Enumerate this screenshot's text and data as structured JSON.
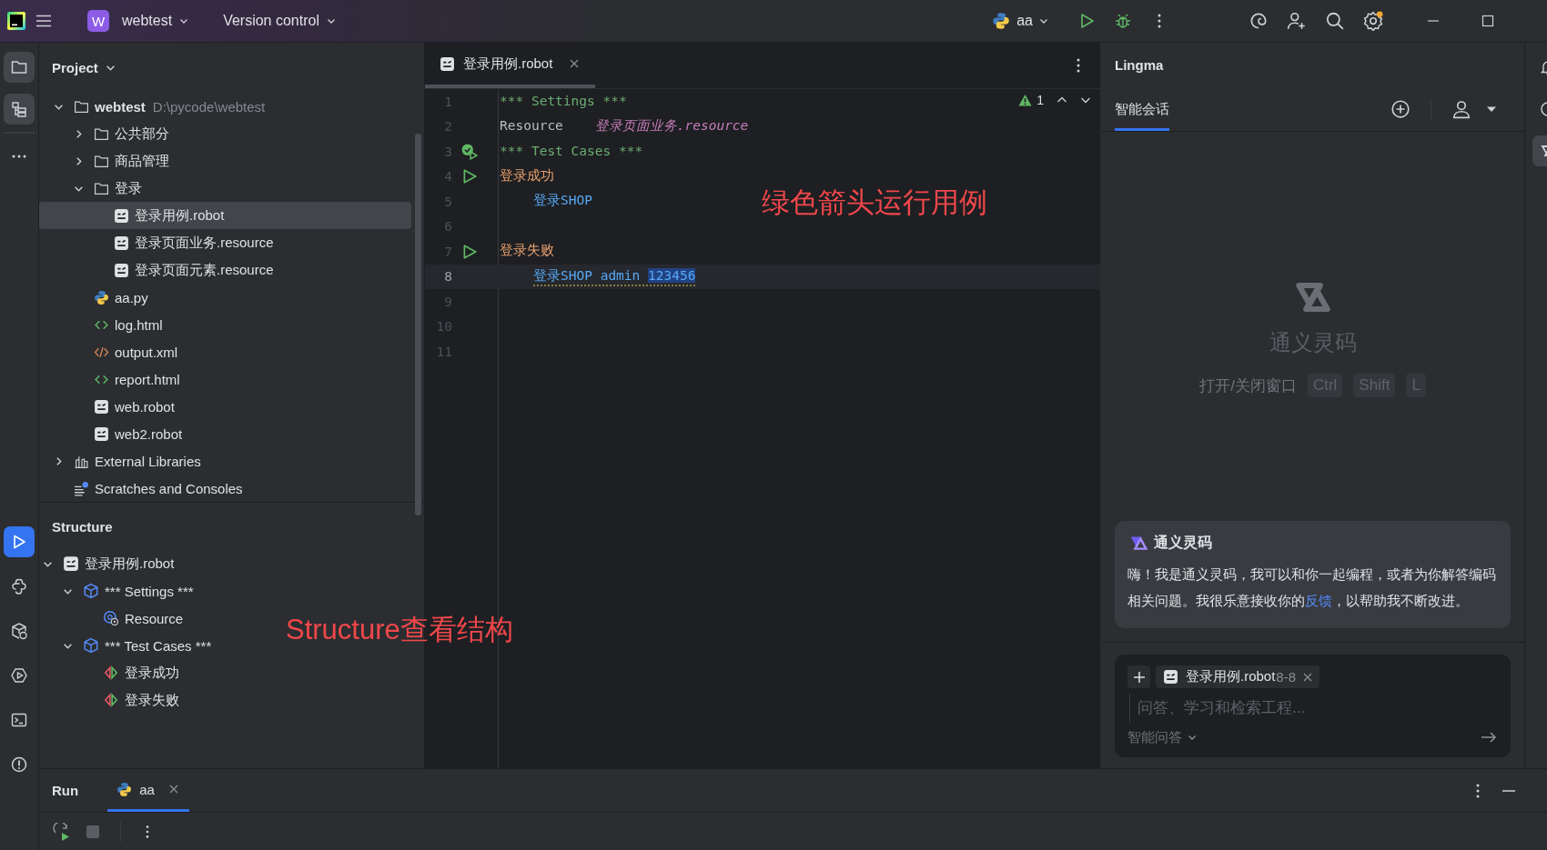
{
  "title_bar": {
    "project_badge": "W",
    "project": "webtest",
    "vcs": "Version control",
    "run_config": "aa"
  },
  "left_toolbar": {
    "top": [
      {
        "kind": "project",
        "selected": true
      },
      {
        "kind": "structure",
        "selected": true
      },
      {
        "kind": "more",
        "selected": false
      }
    ],
    "bottom": [
      {
        "kind": "run",
        "selected": true
      },
      {
        "kind": "python_console",
        "selected": false
      },
      {
        "kind": "packages",
        "selected": false
      },
      {
        "kind": "services",
        "selected": false
      },
      {
        "kind": "terminal",
        "selected": false
      },
      {
        "kind": "problems",
        "selected": false
      }
    ]
  },
  "project_panel": {
    "title": "Project",
    "tree": [
      {
        "label": "webtest",
        "path": "D:\\pycode\\webtest",
        "kind": "folder",
        "expanded": true,
        "selected": false,
        "children": [
          {
            "label": "公共部分",
            "kind": "folder",
            "expanded": false,
            "selected": false
          },
          {
            "label": "商品管理",
            "kind": "folder",
            "expanded": false,
            "selected": false
          },
          {
            "label": "登录",
            "kind": "folder",
            "expanded": true,
            "selected": false,
            "children": [
              {
                "label": "登录用例.robot",
                "kind": "robot",
                "selected": true
              },
              {
                "label": "登录页面业务.resource",
                "kind": "robot",
                "selected": false
              },
              {
                "label": "登录页面元素.resource",
                "kind": "robot",
                "selected": false
              }
            ]
          },
          {
            "label": "aa.py",
            "kind": "python",
            "selected": false
          },
          {
            "label": "log.html",
            "kind": "html",
            "selected": false
          },
          {
            "label": "output.xml",
            "kind": "xml",
            "selected": false
          },
          {
            "label": "report.html",
            "kind": "html",
            "selected": false
          },
          {
            "label": "web.robot",
            "kind": "robot",
            "selected": false
          },
          {
            "label": "web2.robot",
            "kind": "robot",
            "selected": false
          }
        ]
      },
      {
        "label": "External Libraries",
        "kind": "library",
        "expanded": false,
        "selected": false
      },
      {
        "label": "Scratches and Consoles",
        "kind": "scratches",
        "selected": false
      }
    ]
  },
  "structure_panel": {
    "title": "Structure",
    "tree": [
      {
        "label": "登录用例.robot",
        "kind": "robot",
        "expanded": true,
        "selected": false,
        "children": [
          {
            "label": "*** Settings ***",
            "kind": "section",
            "expanded": true,
            "selected": false,
            "children": [
              {
                "label": "Resource",
                "kind": "resource",
                "selected": false
              }
            ]
          },
          {
            "label": "*** Test Cases ***",
            "kind": "section",
            "expanded": true,
            "selected": false,
            "children": [
              {
                "label": "登录成功",
                "kind": "testcase",
                "selected": false
              },
              {
                "label": "登录失败",
                "kind": "testcase",
                "selected": false
              }
            ]
          }
        ]
      }
    ]
  },
  "editor": {
    "tabs": [
      {
        "label": "登录用例.robot",
        "selected": true
      }
    ],
    "warning_count": "1",
    "lines": [
      {
        "number": "1",
        "runnable": false,
        "current": false,
        "indented": false,
        "warning": false,
        "tokens": [
          {
            "text": "*** Settings ***",
            "kind": "header",
            "selected": false
          }
        ]
      },
      {
        "number": "2",
        "runnable": false,
        "current": false,
        "indented": false,
        "warning": false,
        "tokens": [
          {
            "text": "Resource    ",
            "kind": "setting",
            "selected": false
          },
          {
            "text": "登录页面业务.resource",
            "kind": "path",
            "selected": false
          }
        ]
      },
      {
        "number": "3",
        "runnable": true,
        "passed": true,
        "current": false,
        "indented": false,
        "warning": false,
        "tokens": [
          {
            "text": "*** Test Cases ***",
            "kind": "header",
            "selected": false
          }
        ]
      },
      {
        "number": "4",
        "runnable": true,
        "passed": false,
        "current": false,
        "indented": false,
        "warning": false,
        "tokens": [
          {
            "text": "登录成功",
            "kind": "testcase",
            "selected": false
          }
        ]
      },
      {
        "number": "5",
        "runnable": false,
        "current": false,
        "indented": true,
        "warning": false,
        "tokens": [
          {
            "text": "登录SHOP",
            "kind": "keyword",
            "selected": false
          }
        ]
      },
      {
        "number": "6",
        "runnable": false,
        "current": false
      },
      {
        "number": "7",
        "runnable": true,
        "passed": false,
        "current": false,
        "indented": false,
        "warning": false,
        "tokens": [
          {
            "text": "登录失败",
            "kind": "testcase",
            "selected": false
          }
        ]
      },
      {
        "number": "8",
        "runnable": false,
        "current": true,
        "indented": true,
        "warning": true,
        "tokens": [
          {
            "text": "登录SHOP admin ",
            "kind": "keyword",
            "selected": false
          },
          {
            "text": "123456",
            "kind": "keyword",
            "selected": true
          }
        ]
      },
      {
        "number": "9",
        "runnable": false,
        "current": false
      },
      {
        "number": "10",
        "runnable": false,
        "current": false
      },
      {
        "number": "11",
        "runnable": false,
        "current": false
      }
    ]
  },
  "annotations": [
    {
      "text": "绿色箭头运行用例"
    },
    {
      "text": "Structure查看结构"
    }
  ],
  "lingma": {
    "title": "Lingma",
    "tabs": [
      {
        "label": "智能会话",
        "selected": true
      }
    ],
    "empty_state": {
      "name": "通义灵码",
      "hint": "打开/关闭窗口",
      "keys": [
        "Ctrl",
        "Shift",
        "L"
      ]
    },
    "welcome": {
      "title": "通义灵码",
      "text": "嗨！我是通义灵码，我可以和你一起编程，或者为你解答编码相关问题。我很乐意接收你的",
      "link": "反馈",
      "text_after": "，以帮助我不断改进。"
    },
    "composer": {
      "context_file": "登录用例.robot",
      "context_range": "8-8",
      "placeholder": "问答、学习和检索工程...",
      "mode": "智能问答"
    }
  },
  "right_toolbar": [
    {
      "kind": "notifications",
      "selected": false
    },
    {
      "kind": "ai_spiral",
      "selected": false
    },
    {
      "kind": "lingma",
      "selected": true
    }
  ],
  "run_panel": {
    "title": "Run",
    "tabs": [
      {
        "label": "aa",
        "selected": true
      }
    ]
  }
}
